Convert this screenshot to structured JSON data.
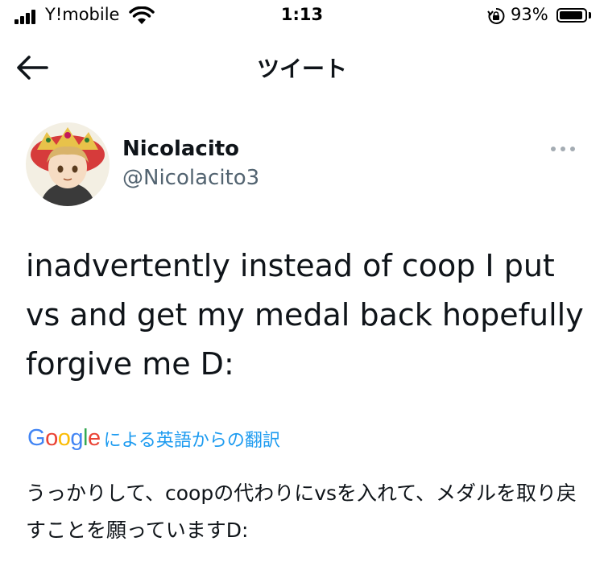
{
  "status_bar": {
    "carrier": "Y!mobile",
    "time": "1:13",
    "battery_percent": "93%",
    "battery_level": 0.93,
    "icons": [
      "signal-icon",
      "wifi-icon",
      "orientation-lock-icon",
      "battery-icon"
    ]
  },
  "nav": {
    "title": "ツイート",
    "back_icon": "arrow-left-icon"
  },
  "tweet": {
    "author": {
      "display_name": "Nicolacito",
      "handle": "@Nicolacito3"
    },
    "more_icon": "more-horizontal-icon",
    "text": "inadvertently instead of coop I put vs and get my medal back hopefully forgive me D:",
    "translation": {
      "provider_logo": [
        "G",
        "o",
        "o",
        "g",
        "l",
        "e"
      ],
      "provider_colors": [
        "#4285F4",
        "#EA4335",
        "#FBBC05",
        "#4285F4",
        "#34A853",
        "#EA4335"
      ],
      "label": "による英語からの翻訳",
      "text": "うっかりして、coopの代わりにvsを入れて、メダルを取り戻すことを願っていますD:"
    }
  }
}
